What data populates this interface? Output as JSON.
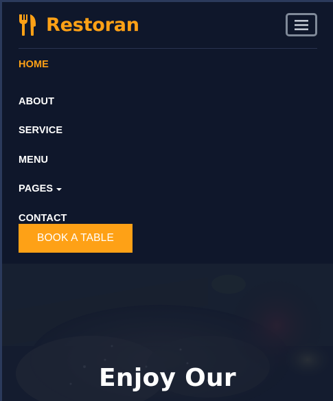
{
  "brand": {
    "name": "Restoran",
    "icon": "utensils-icon",
    "color": "#FEA116"
  },
  "navbar": {
    "background": "#0F172B",
    "toggler_icon": "hamburger-menu-icon",
    "items": [
      {
        "label": "Home",
        "active": true
      },
      {
        "label": "About",
        "active": false
      },
      {
        "label": "Service",
        "active": false
      },
      {
        "label": "Menu",
        "active": false
      },
      {
        "label": "Pages",
        "active": false,
        "dropdown": true,
        "dropdown_icon": "caret-down-icon"
      },
      {
        "label": "Contact",
        "active": false
      }
    ],
    "cta_label": "Book A Table"
  },
  "hero": {
    "title": "Enjoy Our"
  }
}
